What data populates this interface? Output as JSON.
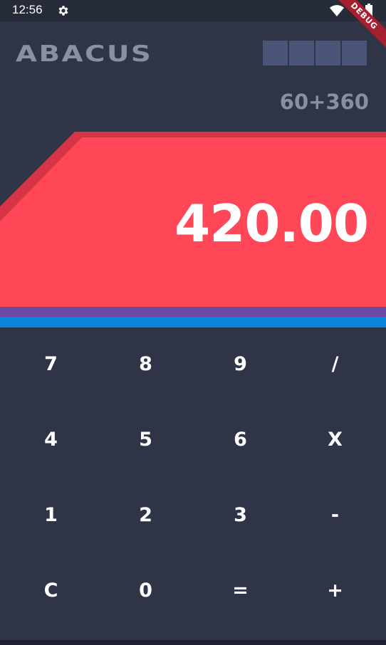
{
  "status_bar": {
    "time": "12:56",
    "icons": [
      "gear-icon",
      "wifi-icon",
      "battery-icon"
    ]
  },
  "debug_banner": "DEBUG",
  "header": {
    "logo": "ABACUS",
    "history_slots": 4
  },
  "display": {
    "expression": "60+360",
    "result": "420.00"
  },
  "keypad": {
    "keys": [
      "7",
      "8",
      "9",
      "/",
      "4",
      "5",
      "6",
      "X",
      "1",
      "2",
      "3",
      "-",
      "C",
      "0",
      "=",
      "+"
    ]
  },
  "colors": {
    "background": "#2f3547",
    "result_panel": "#ff4757",
    "result_panel_dark": "#d63447",
    "stripe_purple": "#6a4aa3",
    "stripe_blue": "#0a84d6",
    "history_box": "#4a5578"
  }
}
